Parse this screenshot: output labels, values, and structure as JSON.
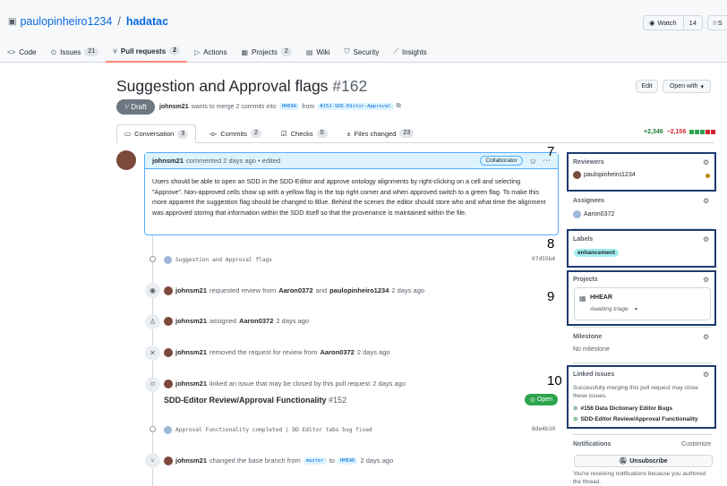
{
  "repo": {
    "owner": "paulopinheiro1234",
    "separator": "/",
    "name": "hadatac"
  },
  "watch": {
    "label": "Watch",
    "count": "14"
  },
  "star": {
    "label": "S"
  },
  "nav": {
    "code": "Code",
    "issues": "Issues",
    "issues_count": "21",
    "pulls": "Pull requests",
    "pulls_count": "2",
    "actions": "Actions",
    "projects": "Projects",
    "projects_count": "2",
    "wiki": "Wiki",
    "security": "Security",
    "insights": "Insights"
  },
  "pr": {
    "title": "Suggestion and Approval flags",
    "number": "#162",
    "state": "Draft",
    "author": "johnsm21",
    "merge_text": "wants to merge 2 commits into",
    "base": "HHEAR",
    "from": "from",
    "head": "#152-SDD-Editor-Approval",
    "edit": "Edit",
    "open_with": "Open with"
  },
  "prtabs": {
    "conversation": "Conversation",
    "conversation_count": "3",
    "commits": "Commits",
    "commits_count": "2",
    "checks": "Checks",
    "checks_count": "0",
    "files": "Files changed",
    "files_count": "23"
  },
  "diffstat": {
    "add": "+2,346",
    "del": "−2,156"
  },
  "comment": {
    "author": "johnsm21",
    "meta": "commented 2 days ago • edited",
    "badge": "Collaborator",
    "body": "Users should be able to open an SDD in the SDD-Editor and approve ontology alignments by right-clicking on a cell and selecting \"Approve\". Non-approved cells show up with a yellow flag in the top right corner and when approved switch to a green flag. To make this more apparent the suggestion flag should be changed to Blue. Behind the scenes the editor should store who and what time the alignment was approved storing that information within the SDD itself so that the provenance is maintained within the file."
  },
  "timeline": {
    "commit1": {
      "msg": "Suggestion and Approval flags",
      "sha": "07d55b4"
    },
    "ev1": {
      "user": "johnsm21",
      "a": "requested review from",
      "u1": "Aaron0372",
      "and": "and",
      "u2": "paulopinheiro1234",
      "time": "2 days ago"
    },
    "ev2": {
      "user": "johnsm21",
      "a": "assigned",
      "u1": "Aaron0372",
      "time": "2 days ago"
    },
    "ev3": {
      "user": "johnsm21",
      "a": "removed the request for review from",
      "u1": "Aaron0372",
      "time": "2 days ago"
    },
    "ev4": {
      "user": "johnsm21",
      "a": "linked an issue that may be closed by this pull request",
      "time": "2 days ago"
    },
    "issue": {
      "title": "SDD-Editor Review/Approval Functionality",
      "num": "#152",
      "state": "Open"
    },
    "commit2": {
      "msg": "Approval Functionality completed | DD Editor tabs bug fixed",
      "sha": "8de4b39"
    },
    "ev5": {
      "user": "johnsm21",
      "a": "changed the base branch from",
      "from": "master",
      "to": "to",
      "branch": "HHEAR",
      "time": "2 days ago"
    }
  },
  "sidebar": {
    "reviewers": {
      "title": "Reviewers",
      "user": "paulopinheiro1234"
    },
    "assignees": {
      "title": "Assignees",
      "user": "Aaron0372"
    },
    "labels": {
      "title": "Labels",
      "label": "enhancement"
    },
    "projects": {
      "title": "Projects",
      "name": "HHEAR",
      "status": "Awaiting triage"
    },
    "milestone": {
      "title": "Milestone",
      "value": "No milestone"
    },
    "linked": {
      "title": "Linked issues",
      "desc": "Successfully merging this pull request may close these issues.",
      "i1": "#156 Data Dictionary Editor Bugs",
      "i2": "SDD-Editor Review/Approval Functionality"
    },
    "notifications": {
      "title": "Notifications",
      "customize": "Customize",
      "button": "Unsubscribe",
      "note": "You're receiving notifications because you authored the thread."
    }
  },
  "annotations": {
    "n7": "7",
    "n8": "8",
    "n9": "9",
    "n10": "10"
  },
  "colors": {
    "accent": "#0969da",
    "annotation_box": "#1e3a6e",
    "open_green": "#2da44e",
    "draft_gray": "#6e7781"
  }
}
